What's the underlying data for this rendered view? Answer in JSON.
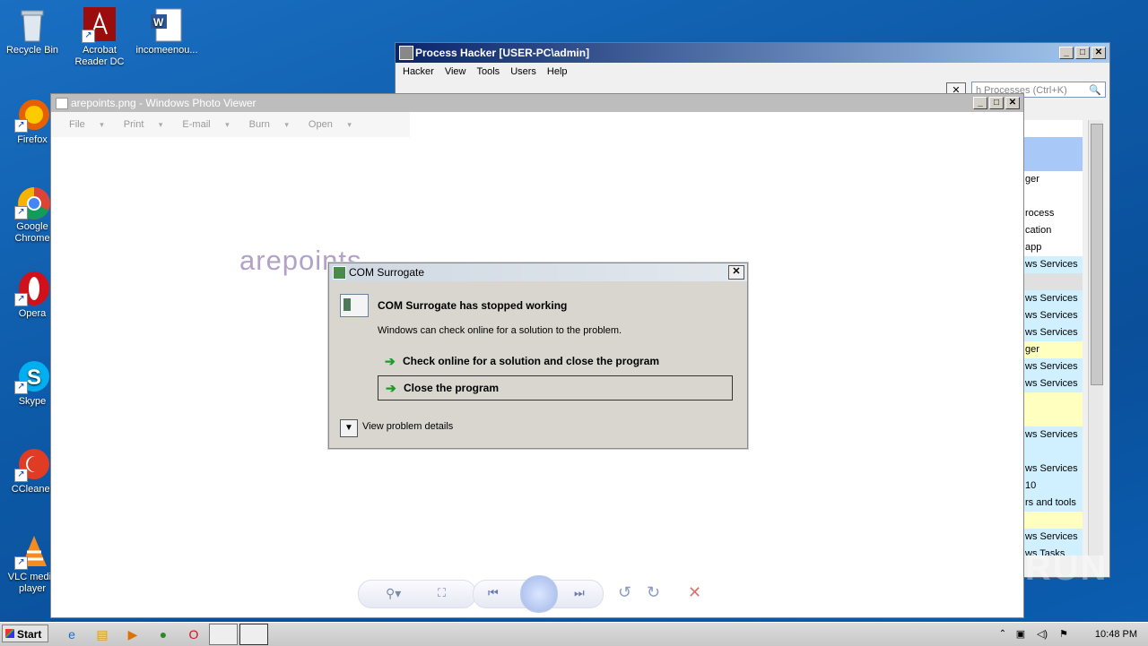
{
  "desktop_icons": [
    {
      "label": "Recycle Bin"
    },
    {
      "label": "Acrobat Reader DC"
    },
    {
      "label": "incomeenou..."
    },
    {
      "label": "Firefox"
    },
    {
      "label": "Google Chrome"
    },
    {
      "label": "Opera"
    },
    {
      "label": "Skype"
    },
    {
      "label": "CCleaner"
    },
    {
      "label": "VLC media player"
    }
  ],
  "process_hacker": {
    "title": "Process Hacker [USER-PC\\admin]",
    "menu": [
      "Hacker",
      "View",
      "Tools",
      "Users",
      "Help"
    ],
    "search_placeholder": "h Processes (Ctrl+K)",
    "rows": [
      "",
      "",
      "ger",
      "",
      "rocess",
      "cation",
      "app",
      "ws Services",
      "",
      "ws Services",
      "ws Services",
      "ws Services",
      "ger",
      "ws Services",
      "ws Services",
      "",
      "",
      "ws Services",
      "",
      "ws Services",
      "10",
      "rs and tools",
      "",
      "ws Services",
      "ws Tasks"
    ]
  },
  "photo_viewer": {
    "title": "arepoints.png - Windows Photo Viewer",
    "menu": [
      "File",
      "Print",
      "E-mail",
      "Burn",
      "Open"
    ],
    "image_text": "arepoints"
  },
  "dialog": {
    "title": "COM Surrogate",
    "heading": "COM Surrogate has stopped working",
    "message": "Windows can check online for a solution to the problem.",
    "option_check": "Check online for a solution and close the program",
    "option_close": "Close the program",
    "details": "View problem details"
  },
  "taskbar": {
    "start": "Start",
    "clock": "10:48 PM"
  },
  "watermark": "ANY RUN"
}
